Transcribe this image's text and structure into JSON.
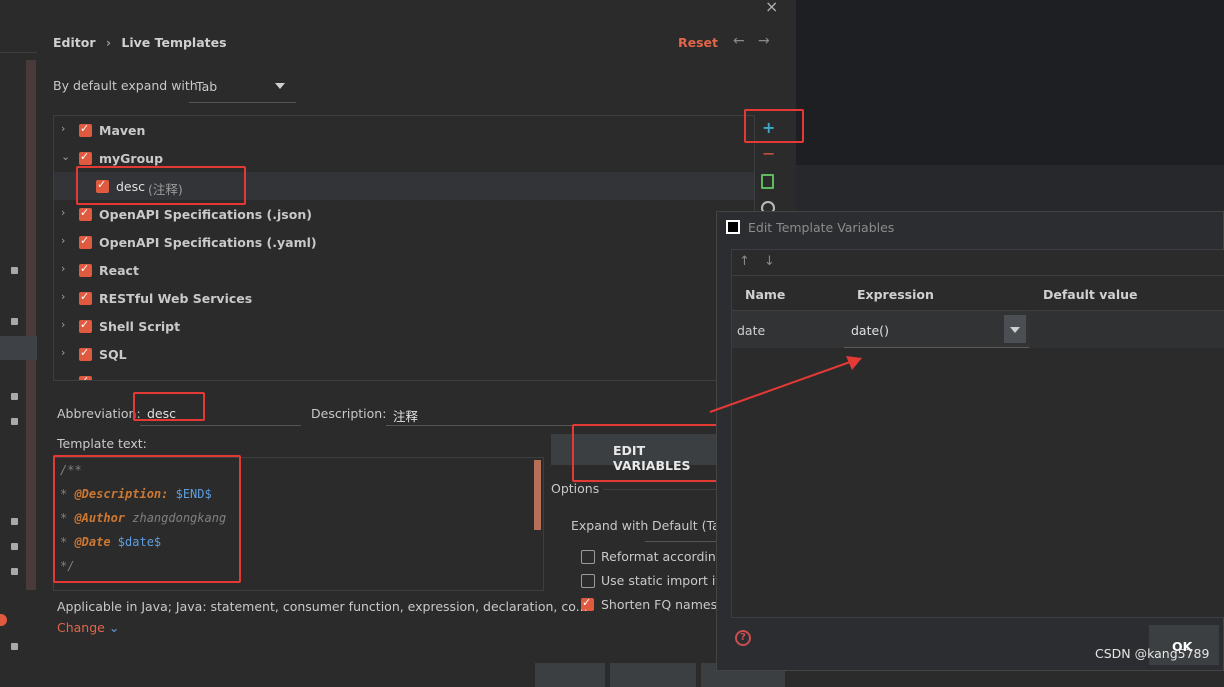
{
  "breadcrumb": {
    "root": "Editor",
    "sep": "›",
    "current": "Live Templates"
  },
  "header": {
    "reset": "Reset",
    "back": "←",
    "forward": "→",
    "close": "×"
  },
  "expand": {
    "label": "By default expand with",
    "value": "Tab"
  },
  "tree": {
    "items": [
      {
        "label": "Maven",
        "chevron": "›"
      },
      {
        "label": "myGroup",
        "chevron": "⌄"
      },
      {
        "label": "desc",
        "note": "(注释)"
      },
      {
        "label": "OpenAPI Specifications (.json)",
        "chevron": "›"
      },
      {
        "label": "OpenAPI Specifications (.yaml)",
        "chevron": "›"
      },
      {
        "label": "React",
        "chevron": "›"
      },
      {
        "label": "RESTful Web Services",
        "chevron": "›"
      },
      {
        "label": "Shell Script",
        "chevron": "›"
      },
      {
        "label": "SQL",
        "chevron": "›"
      }
    ]
  },
  "toolbar": {
    "add": "+",
    "remove": "−",
    "copy_icon": "copy-icon",
    "restore_icon": "restore-icon"
  },
  "abbreviation": {
    "label": "Abbreviation:",
    "value": "desc"
  },
  "description": {
    "label": "Description:",
    "value": "注释"
  },
  "template_text": {
    "label": "Template text:",
    "lines": {
      "l1": "/**",
      "l2_prefix": "* ",
      "l2_tag": "@Description:",
      "l2_var": " $END$",
      "l3_prefix": "* ",
      "l3_tag": "@Author",
      "l3_rest": " zhangdongkang",
      "l4_prefix": "* ",
      "l4_tag": "@Date",
      "l4_var": " $date$",
      "l5": "*/"
    }
  },
  "edit_variables": "EDIT VARIABLES",
  "options": {
    "title": "Options",
    "expand_label": "Expand with",
    "expand_value": "Default (Tal",
    "reformat": "Reformat according",
    "static_import": "Use static import if p",
    "shorten": "Shorten FQ names"
  },
  "applicable": {
    "text": "Applicable in Java; Java: statement, consumer function, expression, declaration, co...",
    "change": "Change"
  },
  "dialog": {
    "title": "Edit Template Variables",
    "up": "↑",
    "down": "↓",
    "columns": [
      "Name",
      "Expression",
      "Default value"
    ],
    "rows": [
      {
        "name": "date",
        "expression": "date()",
        "default": ""
      }
    ],
    "help": "?",
    "ok": "OK"
  },
  "watermark": "CSDN @kang5789",
  "colors": {
    "accent": "#e05a3f",
    "highlight": "#e53935",
    "link": "#5e9ee0"
  }
}
